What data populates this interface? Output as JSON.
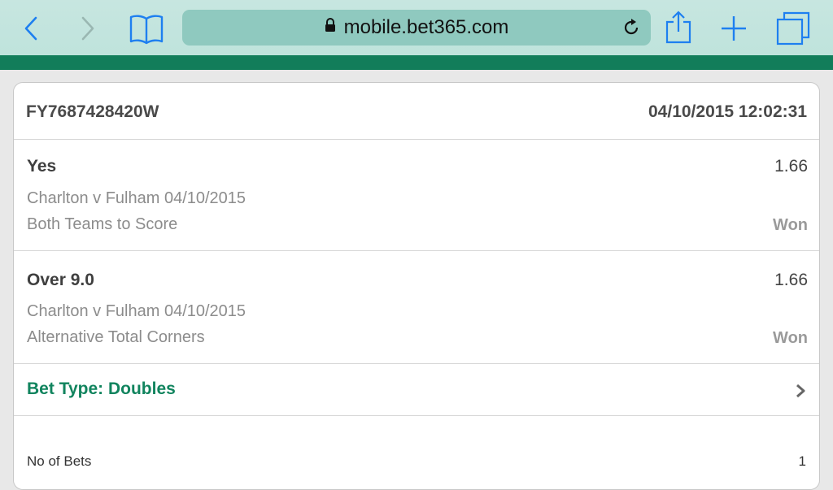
{
  "browser": {
    "url": "mobile.bet365.com",
    "icons": [
      "back-icon",
      "forward-icon",
      "bookmarks-icon",
      "lock-icon",
      "reload-icon",
      "share-icon",
      "new-tab-icon",
      "tabs-icon"
    ]
  },
  "colors": {
    "brand_green": "#127d5a",
    "bet_type_green": "#11845e"
  },
  "bet": {
    "reference": "FY7687428420W",
    "datetime": "04/10/2015 12:02:31",
    "selections": [
      {
        "name": "Yes",
        "odds": "1.66",
        "event": "Charlton v Fulham 04/10/2015",
        "market": "Both Teams to Score",
        "result": "Won"
      },
      {
        "name": "Over 9.0",
        "odds": "1.66",
        "event": "Charlton v Fulham 04/10/2015",
        "market": "Alternative Total Corners",
        "result": "Won"
      }
    ],
    "bet_type_label": "Bet Type: Doubles",
    "no_of_bets_label": "No of Bets",
    "no_of_bets_value": "1"
  }
}
